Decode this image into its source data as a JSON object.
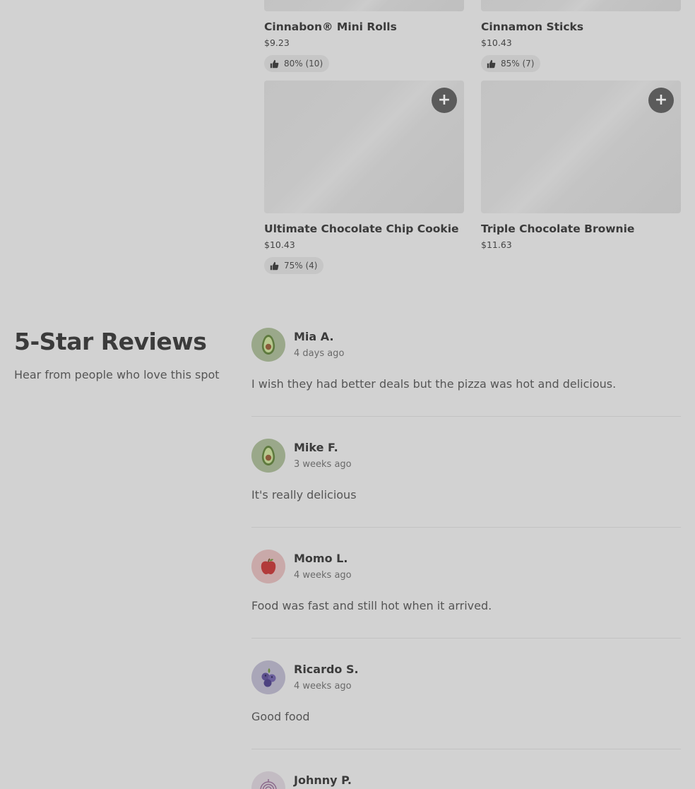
{
  "products": [
    {
      "name": "Cinnabon® Mini Rolls",
      "price": "$9.23",
      "rating": "80% (10)"
    },
    {
      "name": "Cinnamon Sticks",
      "price": "$10.43",
      "rating": "85% (7)"
    },
    {
      "name": "Ultimate Chocolate Chip Cookie",
      "price": "$10.43",
      "rating": "75% (4)",
      "add_label": "+"
    },
    {
      "name": "Triple Chocolate Brownie",
      "price": "$11.63",
      "add_label": "+"
    }
  ],
  "reviews_section": {
    "title": "5-Star Reviews",
    "subtitle": "Hear from people who love this spot"
  },
  "reviews": [
    {
      "name": "Mia A.",
      "time": "4 days ago",
      "text": "I wish they had better deals but the pizza was hot and delicious.",
      "avatar_icon": "avocado-icon"
    },
    {
      "name": "Mike F.",
      "time": "3 weeks ago",
      "text": "It's really delicious",
      "avatar_icon": "avocado-icon"
    },
    {
      "name": "Momo L.",
      "time": "4 weeks ago",
      "text": "Food was fast and still hot when it arrived.",
      "avatar_icon": "apple-icon"
    },
    {
      "name": "Ricardo S.",
      "time": "4 weeks ago",
      "text": "Good food",
      "avatar_icon": "blueberry-icon"
    },
    {
      "name": "Johnny P.",
      "time": "",
      "text": "",
      "avatar_icon": "onion-icon"
    }
  ]
}
